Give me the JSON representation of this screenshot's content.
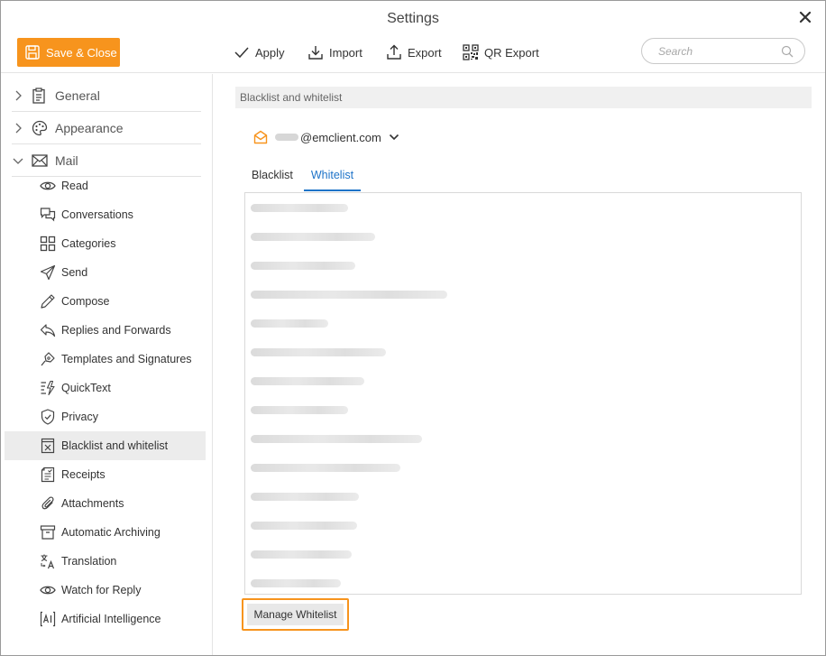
{
  "window": {
    "title": "Settings"
  },
  "toolbar": {
    "save_close": "Save & Close",
    "apply": "Apply",
    "import": "Import",
    "export": "Export",
    "qr_export": "QR Export",
    "search_placeholder": "Search"
  },
  "sidebar": {
    "categories": [
      {
        "label": "General",
        "icon": "clipboard-icon",
        "expanded": false
      },
      {
        "label": "Appearance",
        "icon": "palette-icon",
        "expanded": false
      },
      {
        "label": "Mail",
        "icon": "envelope-icon",
        "expanded": true
      }
    ],
    "mail_items": [
      {
        "label": "Read",
        "icon": "eye-icon"
      },
      {
        "label": "Conversations",
        "icon": "chat-bubbles-icon"
      },
      {
        "label": "Categories",
        "icon": "grid-icon"
      },
      {
        "label": "Send",
        "icon": "paper-plane-icon"
      },
      {
        "label": "Compose",
        "icon": "pencil-icon"
      },
      {
        "label": "Replies and Forwards",
        "icon": "reply-icon"
      },
      {
        "label": "Templates and Signatures",
        "icon": "signature-pen-icon"
      },
      {
        "label": "QuickText",
        "icon": "quicktext-icon"
      },
      {
        "label": "Privacy",
        "icon": "shield-check-icon"
      },
      {
        "label": "Blacklist and whitelist",
        "icon": "blacklist-box-icon",
        "active": true
      },
      {
        "label": "Receipts",
        "icon": "receipt-icon"
      },
      {
        "label": "Attachments",
        "icon": "paperclip-icon"
      },
      {
        "label": "Automatic Archiving",
        "icon": "archive-box-icon"
      },
      {
        "label": "Translation",
        "icon": "translate-icon"
      },
      {
        "label": "Watch for Reply",
        "icon": "eye-icon"
      },
      {
        "label": "Artificial Intelligence",
        "icon": "ai-icon"
      }
    ]
  },
  "main": {
    "section_title": "Blacklist and whitelist",
    "account": {
      "email_suffix": "@emclient.com"
    },
    "tabs": [
      {
        "label": "Blacklist",
        "active": false
      },
      {
        "label": "Whitelist",
        "active": true
      }
    ],
    "whitelist_entry_count": 14,
    "manage_button": "Manage Whitelist"
  },
  "colors": {
    "accent_orange": "#f7941d",
    "active_tab_blue": "#1e73c8",
    "sidebar_active_bg": "#ececec"
  }
}
